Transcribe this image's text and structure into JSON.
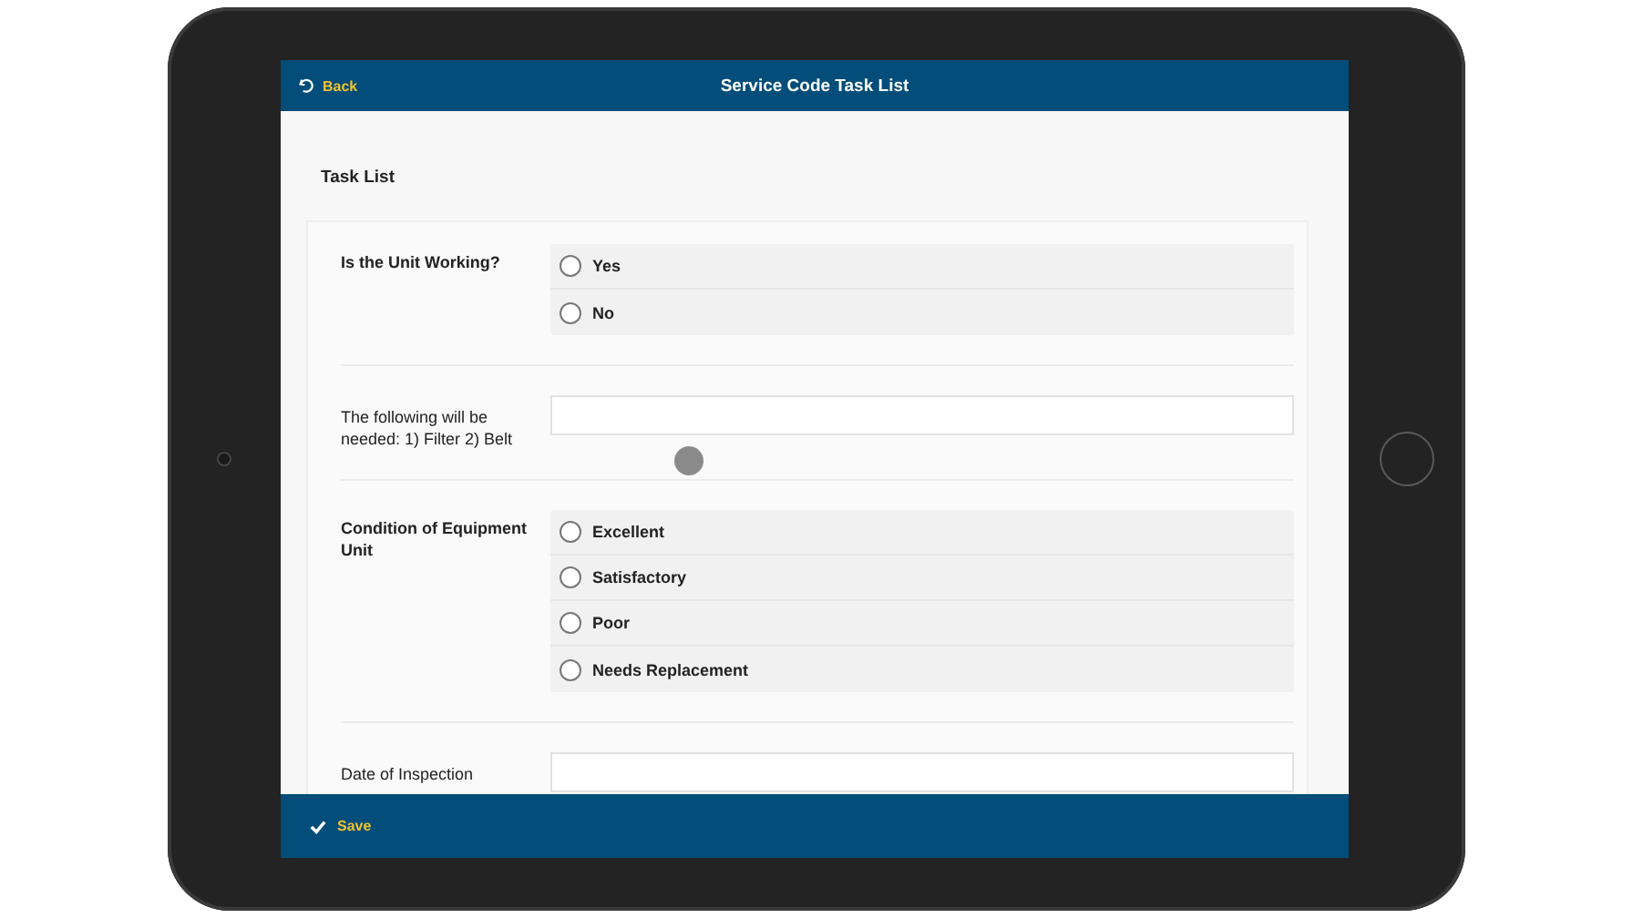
{
  "header": {
    "back": "Back",
    "title": "Service Code Task List"
  },
  "section_title": "Task List",
  "fields": [
    {
      "kind": "radio",
      "label": "Is the Unit Working?",
      "options": [
        {
          "label": "Yes",
          "selected": false
        },
        {
          "label": "No",
          "selected": false
        }
      ]
    },
    {
      "kind": "text",
      "label": "The following will be needed:  1) Filter 2) Belt"
    },
    {
      "kind": "radio",
      "label": "Condition of Equipment Unit",
      "options": [
        {
          "label": "Excellent",
          "selected": false
        },
        {
          "label": "Satisfactory",
          "selected": false
        },
        {
          "label": "Poor",
          "selected": false
        },
        {
          "label": "Needs Replacement",
          "selected": false
        }
      ]
    },
    {
      "kind": "text",
      "label": "Date of Inspection"
    }
  ],
  "footer": {
    "save": "Save"
  }
}
